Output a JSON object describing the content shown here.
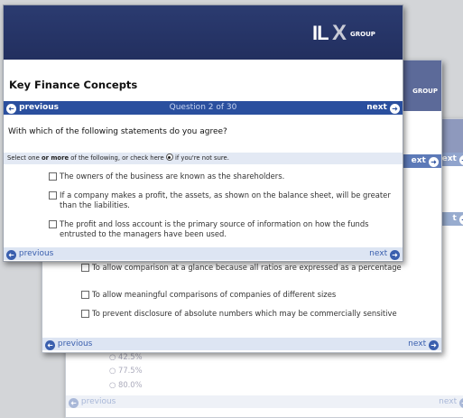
{
  "logo": {
    "letters_left": "IL",
    "letter_x": "X",
    "suffix": "GROUP"
  },
  "win2_logo_partial": "GROUP",
  "win3_logo_partial": "UP",
  "front": {
    "title": "Key Finance Concepts",
    "nav": {
      "previous": "previous",
      "question": "Question 2 of 30",
      "next": "next"
    },
    "question": "With which of the following statements do you agree?",
    "instruction": {
      "prefix": "Select one",
      "bold": "or more",
      "middle": "of the following, or check here",
      "suffix": "if you're not sure."
    },
    "options": [
      "The owners of the business are known as the shareholders.",
      "If a company makes a profit, the assets, as shown on the balance sheet, will be greater than the liabilities.",
      "The profit and loss account is the primary source of information on how the funds entrusted to the managers have been used."
    ],
    "footer": {
      "previous": "previous",
      "next": "next"
    }
  },
  "middle": {
    "top_bar_next": "ext",
    "partial_option": "To allow comparison at a glance because all ratios are expressed as a percentage",
    "options": [
      "To allow meaningful comparisons of companies of different sizes",
      "To prevent disclosure of absolute numbers which may be commercially sensitive"
    ],
    "footer": {
      "previous": "previous",
      "next": "next"
    }
  },
  "back": {
    "bar_next": "ext",
    "bar_next2": "t",
    "radio_options": [
      "42.5%",
      "77.5%",
      "80.0%"
    ],
    "footer": {
      "previous": "previous",
      "next": "next"
    }
  }
}
